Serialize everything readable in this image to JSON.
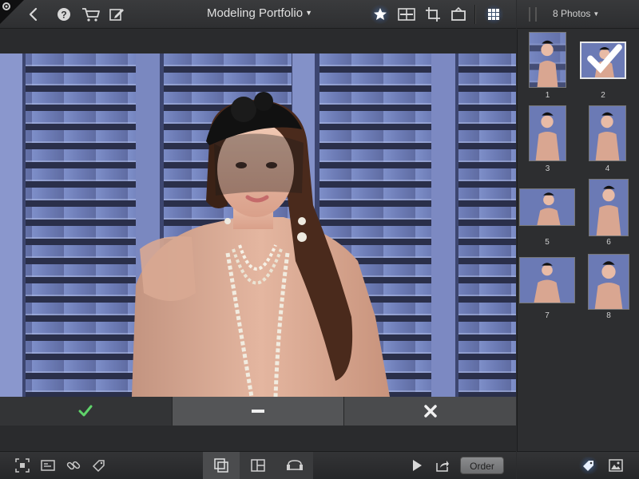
{
  "app": {
    "album_title": "Modeling Portfolio",
    "photo_count": "8 Photos"
  },
  "toolbar": {
    "icons": [
      "settings-icon",
      "back-icon",
      "help-icon",
      "cart-icon",
      "edit-icon",
      "star-icon",
      "compare-icon",
      "crop-icon",
      "frame-icon",
      "grid-icon"
    ]
  },
  "decisions": {
    "accept_icon": "checkmark-icon",
    "neutral_icon": "minus-icon",
    "reject_icon": "x-icon",
    "accept_color": "#5fd36a"
  },
  "bottom_toolbar": {
    "order_label": "Order",
    "icons": [
      "fit-icon",
      "info-card-icon",
      "link-icon",
      "tag-add-icon",
      "single-view-icon",
      "compare-view-icon",
      "couch-icon",
      "play-icon",
      "share-icon",
      "tag-icon",
      "image-icon"
    ]
  },
  "thumbnails": [
    {
      "number": "1",
      "selected": false
    },
    {
      "number": "2",
      "selected": true
    },
    {
      "number": "3",
      "selected": false
    },
    {
      "number": "4",
      "selected": false
    },
    {
      "number": "5",
      "selected": false
    },
    {
      "number": "6",
      "selected": false
    },
    {
      "number": "7",
      "selected": false
    },
    {
      "number": "8",
      "selected": false
    }
  ],
  "colors": {
    "accent": "#5aa2ff",
    "background": "#2b2c2e"
  }
}
